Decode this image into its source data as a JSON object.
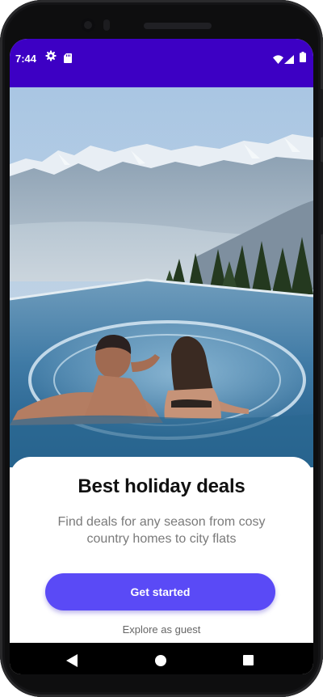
{
  "status_bar": {
    "time": "7:44",
    "icons": [
      "gear-icon",
      "sd-card-icon",
      "wifi-icon",
      "signal-icon",
      "battery-icon"
    ],
    "background": "#3d00c4"
  },
  "hero": {
    "image": "couple-in-infinity-pool-mountain-lake-view"
  },
  "card": {
    "title": "Best holiday deals",
    "subtitle": "Find deals for any season from cosy country homes to city flats",
    "cta_label": "Get started",
    "secondary_link": "Explore as guest",
    "accent": "#5a4af6"
  },
  "nav_bar": {
    "buttons": [
      "back-icon",
      "home-icon",
      "recents-icon"
    ]
  }
}
